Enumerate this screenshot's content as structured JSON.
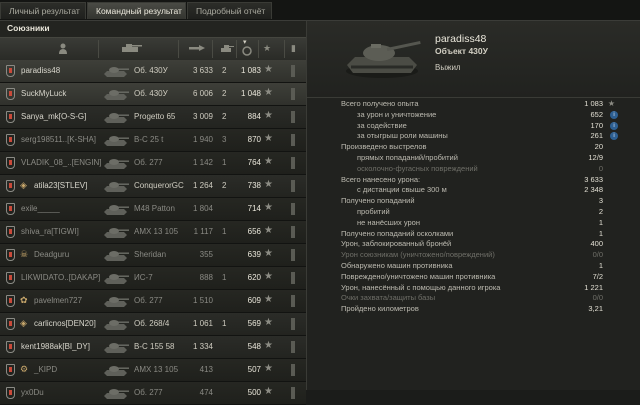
{
  "tabs": [
    {
      "label": "Личный результат"
    },
    {
      "label": "Командный результат"
    },
    {
      "label": "Подробный отчёт"
    }
  ],
  "left": {
    "title": "Союзники",
    "players": [
      {
        "name": "paradiss48",
        "tank": "Об. 430У",
        "damage": "3 633",
        "frags": "2",
        "xp": "1 083",
        "state": "me"
      },
      {
        "name": "SuckMyLuck",
        "tank": "Об. 430У",
        "damage": "6 006",
        "frags": "2",
        "xp": "1 048",
        "state": "me"
      },
      {
        "name": "Sanya_mk[O-S-G]",
        "tank": "Progetto 65",
        "damage": "3 009",
        "frags": "2",
        "xp": "884",
        "state": "alive"
      },
      {
        "name": "serg198511..[K-SHA]",
        "tank": "B-C 25 t",
        "damage": "1 940",
        "frags": "3",
        "xp": "870",
        "state": "dead"
      },
      {
        "name": "VLADIK_08_..[ENGIN]",
        "tank": "Об. 277",
        "damage": "1 142",
        "frags": "1",
        "xp": "764",
        "state": "dead"
      },
      {
        "name": "atila23[STLEV]",
        "clan": "◈",
        "tank": "ConquerorGC",
        "damage": "1 264",
        "frags": "2",
        "xp": "738",
        "state": "alive"
      },
      {
        "name": "exile_____",
        "tank": "M48 Patton",
        "damage": "1 804",
        "frags": "",
        "xp": "714",
        "state": "dead"
      },
      {
        "name": "shiva_ra[TIGWI]",
        "tank": "AMX 13 105",
        "damage": "1 117",
        "frags": "1",
        "xp": "656",
        "state": "dead"
      },
      {
        "name": "Deadguru",
        "clan": "☠",
        "tank": "Sheridan",
        "damage": "355",
        "frags": "",
        "xp": "639",
        "state": "dead"
      },
      {
        "name": "LIKWIDATO..[DAKAP]",
        "tank": "ИС-7",
        "damage": "888",
        "frags": "1",
        "xp": "620",
        "state": "dead"
      },
      {
        "name": "pavelmen727",
        "clan": "✿",
        "tank": "Об. 277",
        "damage": "1 510",
        "frags": "",
        "xp": "609",
        "state": "dead"
      },
      {
        "name": "carlicnos[DEN20]",
        "clan": "◈",
        "tank": "Об. 268/4",
        "damage": "1 061",
        "frags": "1",
        "xp": "569",
        "state": "alive"
      },
      {
        "name": "kent1988ak[BI_DY]",
        "tank": "B-C 155 58",
        "damage": "1 334",
        "frags": "",
        "xp": "548",
        "state": "alive"
      },
      {
        "name": "_KIPD",
        "clan": "⚙",
        "tank": "AMX 13 105",
        "damage": "413",
        "frags": "",
        "xp": "507",
        "state": "dead"
      },
      {
        "name": "yx0Du",
        "tank": "Об. 277",
        "damage": "474",
        "frags": "",
        "xp": "500",
        "state": "dead"
      }
    ]
  },
  "player": {
    "name": "paradiss48",
    "vehicle": "Объект 430У",
    "status": "Выжил"
  },
  "stats": [
    {
      "label": "Всего получено опыта",
      "value": "1 083",
      "suffix": "star"
    },
    {
      "label": "за урон и уничтожение",
      "value": "652",
      "indent": true,
      "suffix": "info"
    },
    {
      "label": "за содействие",
      "value": "170",
      "indent": true,
      "suffix": "info"
    },
    {
      "label": "за отыгрыш роли машины",
      "value": "261",
      "indent": true,
      "suffix": "info"
    },
    {
      "label": "Произведено выстрелов",
      "value": "20"
    },
    {
      "label": "прямых попаданий/пробитий",
      "value": "12/9",
      "indent": true
    },
    {
      "label": "осколочно-фугасных повреждений",
      "value": "0",
      "indent": true,
      "muted": true
    },
    {
      "label": "Всего нанесено урона:",
      "value": "3 633"
    },
    {
      "label": "с дистанции свыше 300 м",
      "value": "2 348",
      "indent": true
    },
    {
      "label": "Получено попаданий",
      "value": "3"
    },
    {
      "label": "пробитий",
      "value": "2",
      "indent": true
    },
    {
      "label": "не нанёсших урон",
      "value": "1",
      "indent": true
    },
    {
      "label": "Получено попаданий осколками",
      "value": "1"
    },
    {
      "label": "Урон, заблокированный бронёй",
      "value": "400"
    },
    {
      "label": "Урон союзникам (уничтожено/повреждений)",
      "value": "0/0",
      "muted": true
    },
    {
      "label": "Обнаружено машин противника",
      "value": "1"
    },
    {
      "label": "Повреждено/уничтожено машин противника",
      "value": "7/2"
    },
    {
      "label": "Урон, нанесённый с помощью данного игрока",
      "value": "1 221"
    },
    {
      "label": "Очки захвата/защиты базы",
      "value": "0/0",
      "muted": true
    },
    {
      "label": "Пройдено километров",
      "value": "3,21"
    }
  ]
}
